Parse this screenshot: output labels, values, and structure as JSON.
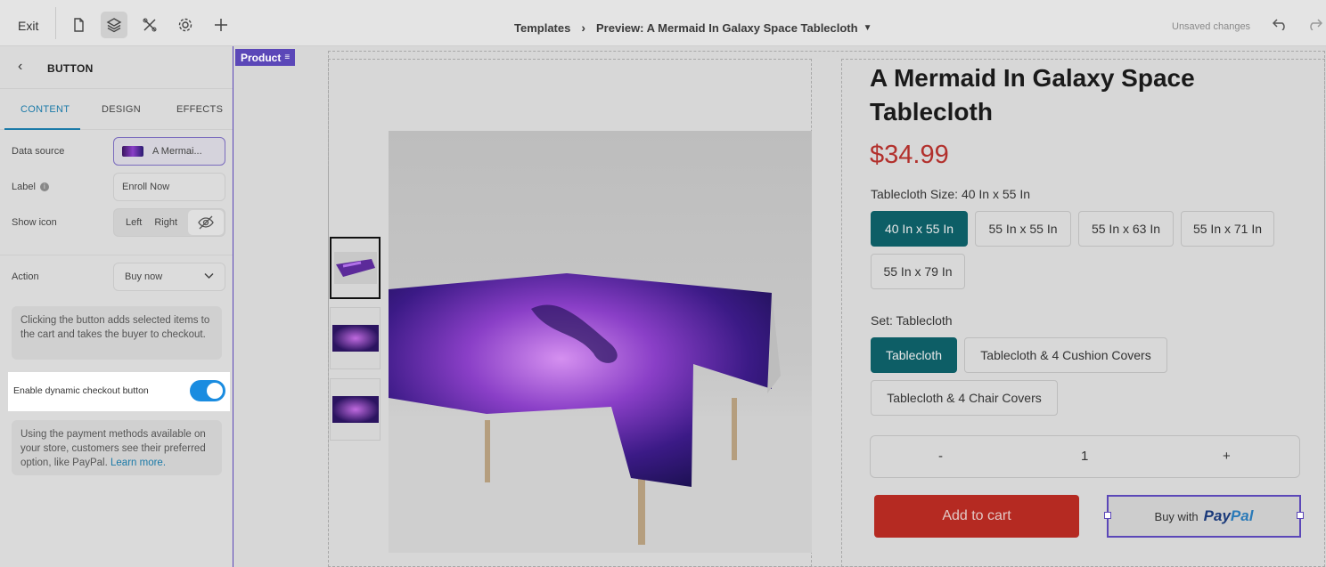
{
  "topbar": {
    "exit_label": "Exit",
    "breadcrumb_root": "Templates",
    "breadcrumb_current": "Preview: A Mermaid In Galaxy Space Tablecloth",
    "unsaved": "Unsaved changes"
  },
  "panel": {
    "title": "BUTTON",
    "tabs": [
      "CONTENT",
      "DESIGN",
      "EFFECTS"
    ],
    "data_source_label": "Data source",
    "data_source_value": "A Mermai...",
    "label_label": "Label",
    "label_value": "Enroll Now",
    "show_icon_label": "Show icon",
    "show_icon_left": "Left",
    "show_icon_right": "Right",
    "action_label": "Action",
    "action_value": "Buy now",
    "action_note": "Clicking the button adds selected items to the cart and takes the buyer to checkout.",
    "toggle_label": "Enable dynamic checkout button",
    "toggle_on": true,
    "dynamic_note": "Using the payment methods available on your store, customers see their preferred option, like PayPal.",
    "learn_more": "Learn more."
  },
  "canvas": {
    "product_tag": "Product",
    "title": "A Mermaid In Galaxy Space Tablecloth",
    "price": "$34.99",
    "size_label": "Tablecloth Size: 40 In x 55 In",
    "sizes": [
      "40 In x 55 In",
      "55 In x 55 In",
      "55 In x 63 In",
      "55 In x 71 In",
      "55 In x 79 In"
    ],
    "set_label": "Set: Tablecloth",
    "sets": [
      "Tablecloth",
      "Tablecloth & 4 Cushion Covers",
      "Tablecloth & 4 Chair Covers"
    ],
    "qty_minus": "-",
    "qty_value": "1",
    "qty_plus": "+",
    "add_to_cart": "Add to cart",
    "buy_with": "Buy with",
    "paypal_a": "Pay",
    "paypal_b": "Pal"
  }
}
